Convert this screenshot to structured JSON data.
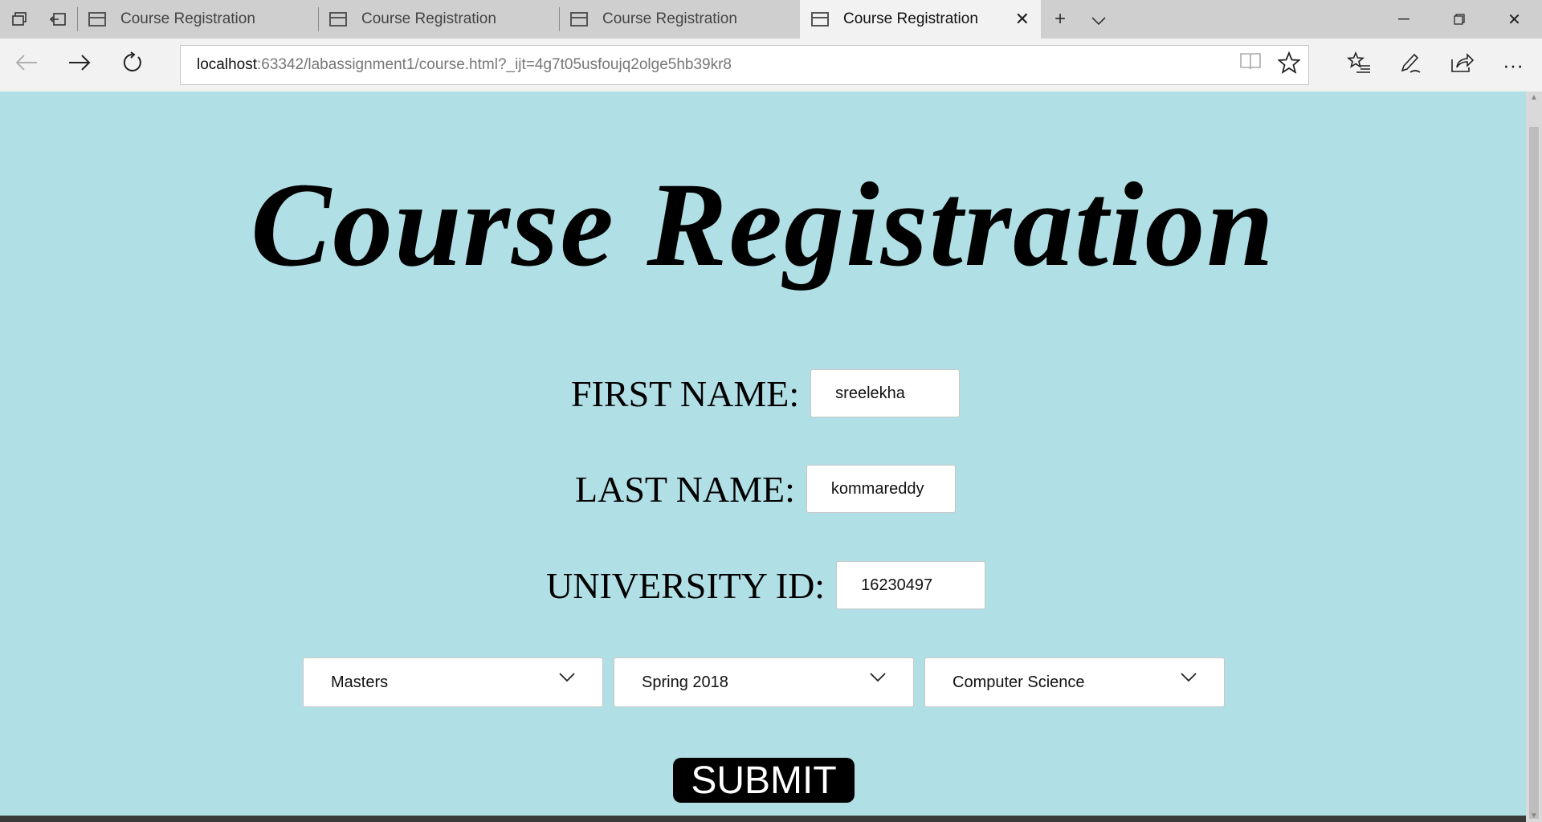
{
  "browser": {
    "tabs": [
      {
        "title": "Course Registration"
      },
      {
        "title": "Course Registration"
      },
      {
        "title": "Course Registration"
      },
      {
        "title": "Course Registration",
        "active": true
      }
    ],
    "url_host": "localhost",
    "url_rest": ":63342/labassignment1/course.html?_ijt=4g7t05usfoujq2olge5hb39kr8",
    "icons": [
      "tab-list-icon",
      "set-aside-icon",
      "new-tab-icon",
      "tab-preview-icon",
      "back-icon",
      "forward-icon",
      "refresh-icon",
      "reading-view-icon",
      "favorite-star-icon",
      "favorites-hub-icon",
      "annotate-pen-icon",
      "share-icon",
      "more-icon"
    ]
  },
  "page": {
    "title": "Course Registration",
    "first_name_label": "FIRST NAME:",
    "first_name_value": "sreelekha",
    "last_name_label": "LAST NAME:",
    "last_name_value": "kommareddy",
    "university_id_label": "UNIVERSITY ID:",
    "university_id_value": "16230497",
    "degree_selected": "Masters",
    "term_selected": "Spring 2018",
    "department_selected": "Computer Science",
    "submit_label": "SUBMIT",
    "background_color": "#b0dfe5"
  }
}
